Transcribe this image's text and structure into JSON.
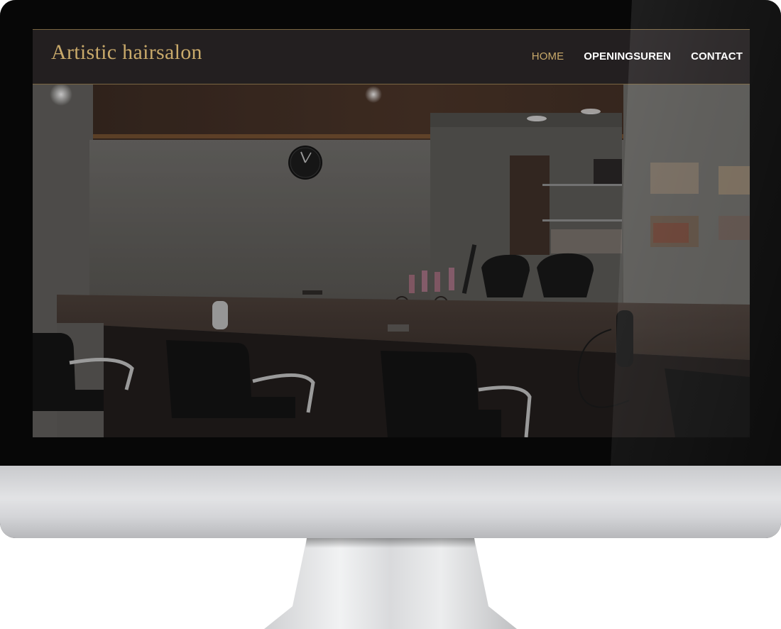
{
  "site": {
    "logo_text": "Artistic hairsalon",
    "nav": [
      {
        "label": "HOME",
        "active": true
      },
      {
        "label": "OPENINGSUREN",
        "active": false
      },
      {
        "label": "CONTACT",
        "active": false
      }
    ]
  },
  "hero": {
    "image_description_icon": "salon-interior-photo"
  },
  "colors": {
    "accent_gold": "#c8a96a",
    "header_bg": "#231f20",
    "nav_text": "#ffffff"
  }
}
